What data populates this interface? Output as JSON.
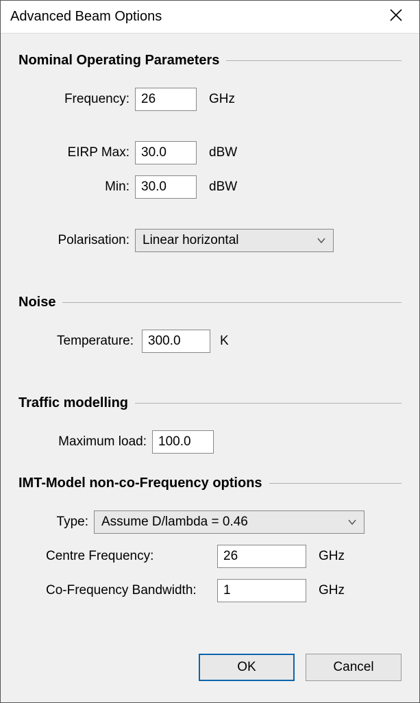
{
  "title": "Advanced Beam Options",
  "sections": {
    "nop": {
      "heading": "Nominal Operating Parameters",
      "frequency_label": "Frequency:",
      "frequency_value": "26",
      "frequency_unit": "GHz",
      "eirp_max_label": "EIRP Max:",
      "eirp_max_value": "30.0",
      "eirp_max_unit": "dBW",
      "eirp_min_label": "Min:",
      "eirp_min_value": "30.0",
      "eirp_min_unit": "dBW",
      "polarisation_label": "Polarisation:",
      "polarisation_value": "Linear horizontal"
    },
    "noise": {
      "heading": "Noise",
      "temperature_label": "Temperature:",
      "temperature_value": "300.0",
      "temperature_unit": "K"
    },
    "traffic": {
      "heading": "Traffic modelling",
      "max_load_label": "Maximum load:",
      "max_load_value": "100.0"
    },
    "imt": {
      "heading": "IMT-Model non-co-Frequency options",
      "type_label": "Type:",
      "type_value": "Assume D/lambda = 0.46",
      "centre_freq_label": "Centre Frequency:",
      "centre_freq_value": "26",
      "centre_freq_unit": "GHz",
      "co_freq_bw_label": "Co-Frequency Bandwidth:",
      "co_freq_bw_value": "1",
      "co_freq_bw_unit": "GHz"
    }
  },
  "buttons": {
    "ok": "OK",
    "cancel": "Cancel"
  }
}
